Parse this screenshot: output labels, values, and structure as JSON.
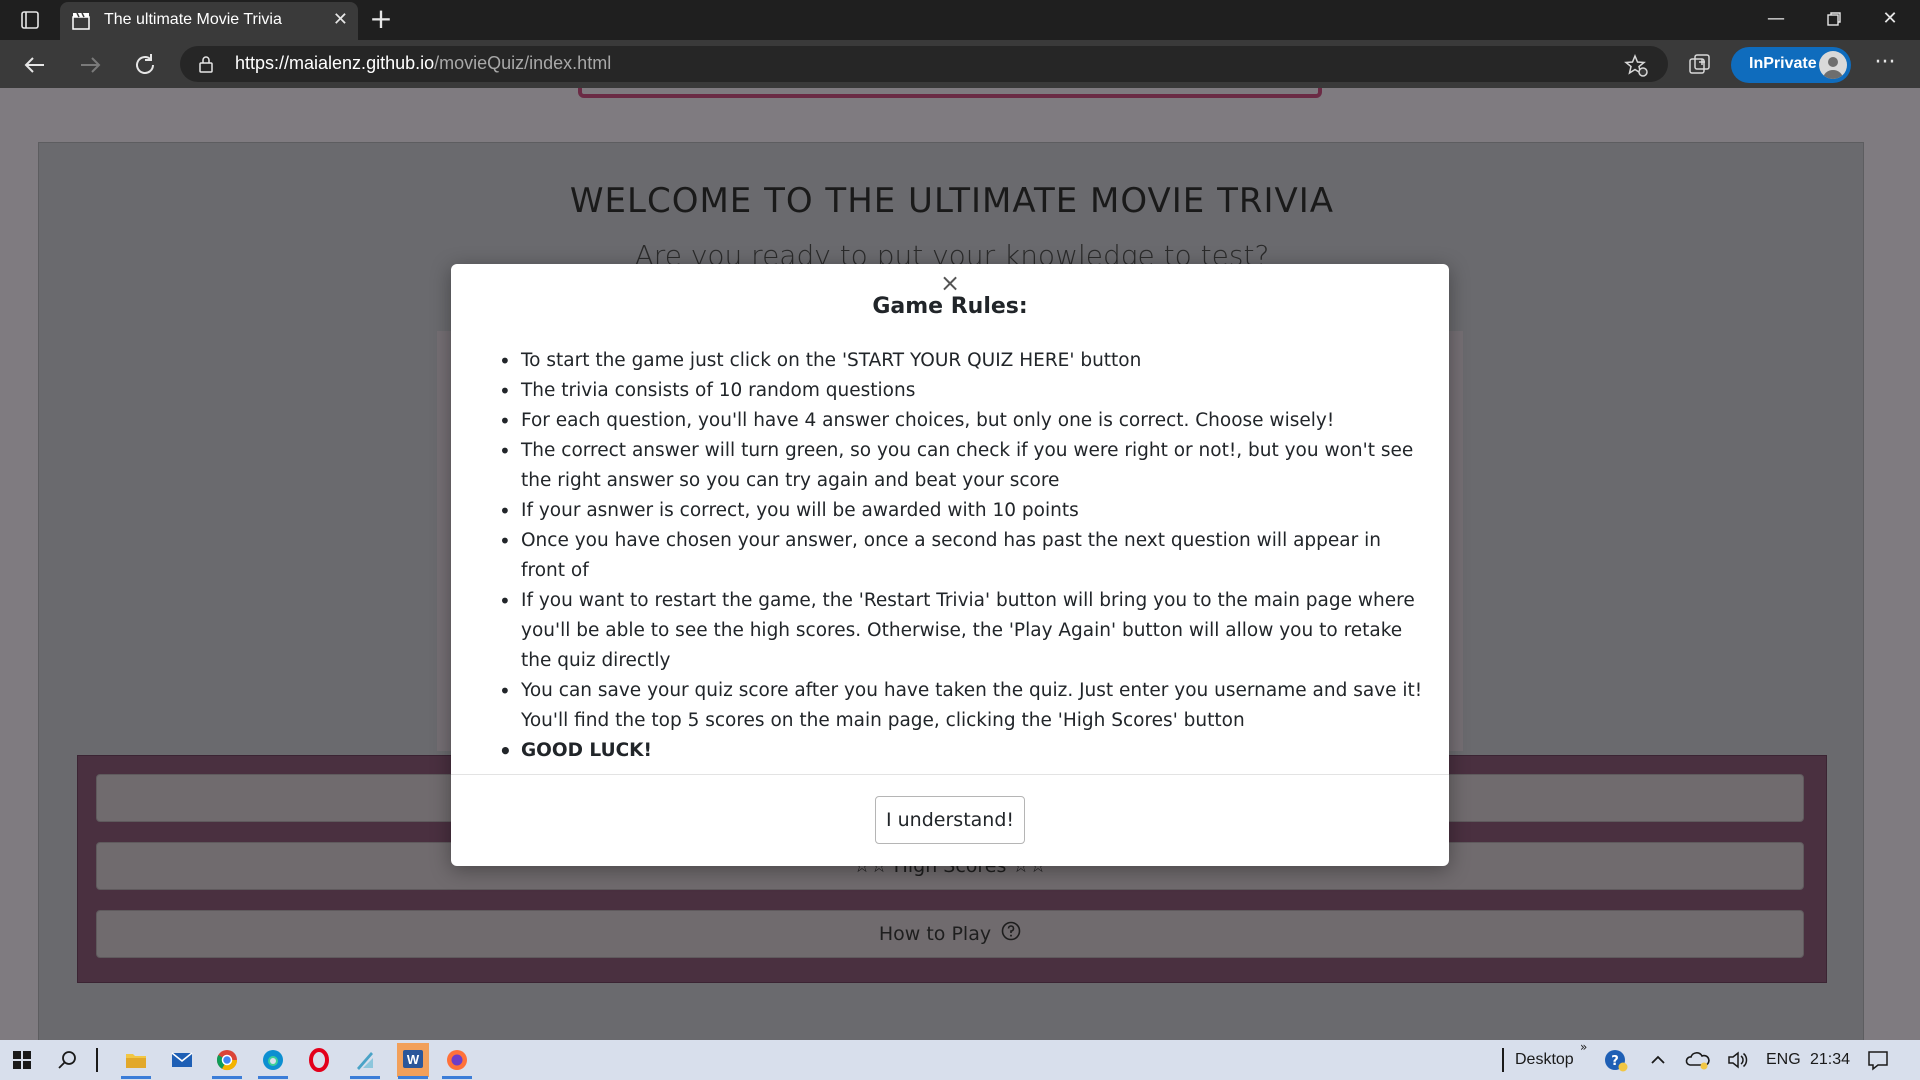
{
  "browser": {
    "tab_title": "The ultimate Movie Trivia",
    "url_main": "https://maialenz.github.io",
    "url_path": "/movieQuiz/index.html",
    "inprivate_label": "InPrivate"
  },
  "page": {
    "heading": "WELCOME TO THE ULTIMATE MOVIE TRIVIA",
    "subheading": "Are you ready to put your knowledge to test?",
    "buttons": {
      "high_scores": "☆☆ High Scores ☆☆",
      "how_to_play": "How to Play"
    }
  },
  "modal": {
    "close_symbol": "×",
    "title": "Game Rules:",
    "rules": [
      "To start the game just click on the 'START YOUR QUIZ HERE' button",
      "The trivia consists of 10 random questions",
      "For each question, you'll have 4 answer choices, but only one is correct. Choose wisely!",
      "The correct answer will turn green, so you can check if you were right or not!, but you won't see the right answer so you can try again and beat your score",
      "If your asnwer is correct, you will be awarded with 10 points",
      "Once you have chosen your answer, once a second has past the next question will appear in front of",
      "If you want to restart the game, the 'Restart Trivia' button will bring you to the main page where you'll be able to see the high scores. Otherwise, the 'Play Again' button will allow you to retake the quiz directly",
      "You can save your quiz score after you have taken the quiz. Just enter you username and save it! You'll find the top 5 scores on the main page, clicking the 'High Scores' button",
      "GOOD LUCK!"
    ],
    "confirm_label": "I understand!"
  },
  "taskbar": {
    "desktop_label": "Desktop",
    "language": "ENG",
    "time": "21:34"
  },
  "colors": {
    "inprivate_blue": "#0f6cbd",
    "panel_maroon": "#4a3040",
    "frame_maroon": "#6b2b45"
  }
}
